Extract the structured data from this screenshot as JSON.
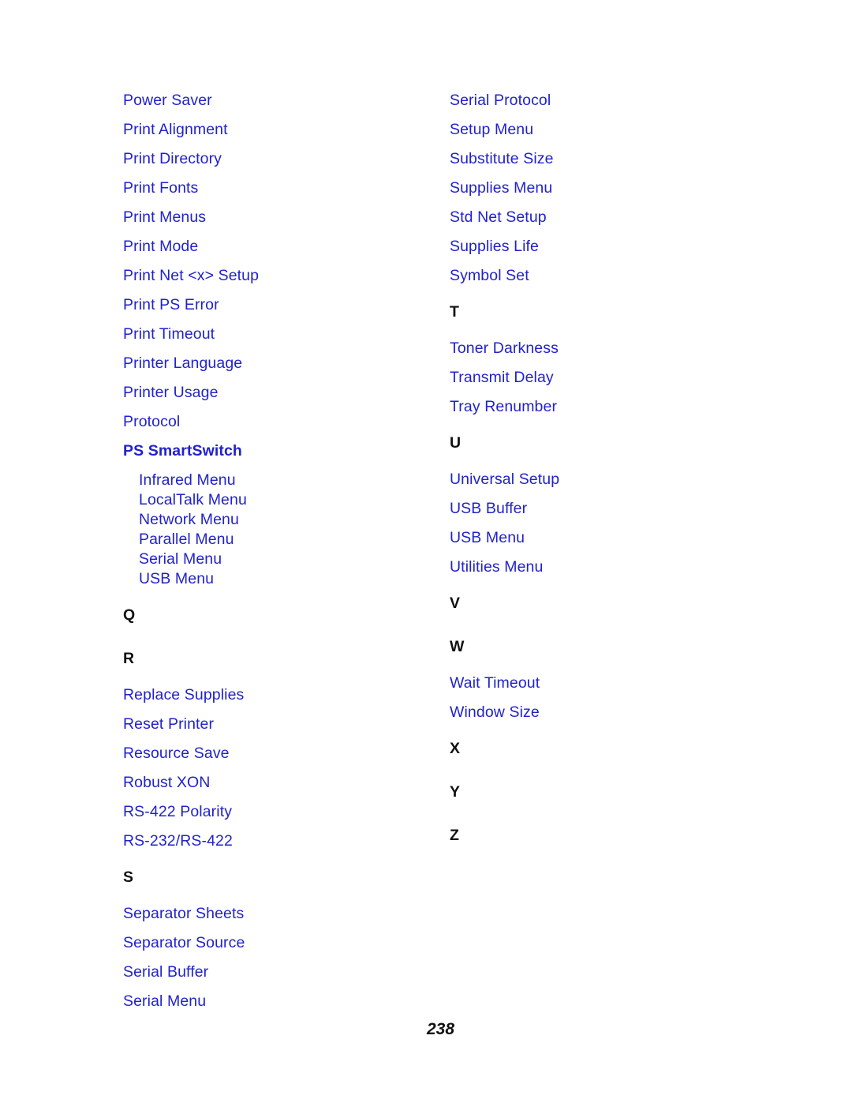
{
  "page": {
    "number": "238",
    "link_color": "#2222cc",
    "heading_color": "#111111",
    "background_color": "#ffffff"
  },
  "columns": {
    "left": [
      {
        "kind": "entry",
        "text": "Power Saver"
      },
      {
        "kind": "entry",
        "text": "Print Alignment"
      },
      {
        "kind": "entry",
        "text": "Print Directory"
      },
      {
        "kind": "entry",
        "text": "Print Fonts"
      },
      {
        "kind": "entry",
        "text": "Print Menus"
      },
      {
        "kind": "entry",
        "text": "Print Mode"
      },
      {
        "kind": "entry",
        "text": "Print Net <x> Setup"
      },
      {
        "kind": "entry",
        "text": "Print PS Error"
      },
      {
        "kind": "entry",
        "text": "Print Timeout"
      },
      {
        "kind": "entry",
        "text": "Printer Language"
      },
      {
        "kind": "entry",
        "text": "Printer Usage"
      },
      {
        "kind": "entry",
        "text": "Protocol"
      },
      {
        "kind": "entry-bold",
        "text": "PS SmartSwitch"
      },
      {
        "kind": "sub",
        "text": "Infrared Menu"
      },
      {
        "kind": "sub",
        "text": "LocalTalk Menu"
      },
      {
        "kind": "sub",
        "text": "Network Menu"
      },
      {
        "kind": "sub",
        "text": "Parallel Menu"
      },
      {
        "kind": "sub",
        "text": "Serial Menu"
      },
      {
        "kind": "sub",
        "text": "USB Menu"
      },
      {
        "kind": "gap",
        "text": ""
      },
      {
        "kind": "letter",
        "text": "Q"
      },
      {
        "kind": "letter",
        "text": "R"
      },
      {
        "kind": "entry",
        "text": "Replace Supplies"
      },
      {
        "kind": "entry",
        "text": "Reset Printer"
      },
      {
        "kind": "entry",
        "text": "Resource Save"
      },
      {
        "kind": "entry",
        "text": "Robust XON"
      },
      {
        "kind": "entry",
        "text": "RS-422 Polarity"
      },
      {
        "kind": "entry",
        "text": "RS-232/RS-422"
      },
      {
        "kind": "letter",
        "text": "S"
      },
      {
        "kind": "entry",
        "text": "Separator Sheets"
      },
      {
        "kind": "entry",
        "text": "Separator Source"
      },
      {
        "kind": "entry",
        "text": "Serial Buffer"
      },
      {
        "kind": "entry",
        "text": "Serial Menu"
      }
    ],
    "right": [
      {
        "kind": "entry",
        "text": "Serial Protocol"
      },
      {
        "kind": "entry",
        "text": "Setup Menu"
      },
      {
        "kind": "entry",
        "text": "Substitute Size"
      },
      {
        "kind": "entry",
        "text": "Supplies Menu"
      },
      {
        "kind": "entry",
        "text": "Std Net Setup"
      },
      {
        "kind": "entry",
        "text": "Supplies Life"
      },
      {
        "kind": "entry",
        "text": "Symbol Set"
      },
      {
        "kind": "letter",
        "text": "T"
      },
      {
        "kind": "entry",
        "text": "Toner Darkness"
      },
      {
        "kind": "entry",
        "text": "Transmit Delay"
      },
      {
        "kind": "entry",
        "text": "Tray Renumber"
      },
      {
        "kind": "letter",
        "text": "U"
      },
      {
        "kind": "entry",
        "text": "Universal Setup"
      },
      {
        "kind": "entry",
        "text": "USB Buffer"
      },
      {
        "kind": "entry",
        "text": "USB Menu"
      },
      {
        "kind": "entry",
        "text": "Utilities Menu"
      },
      {
        "kind": "letter",
        "text": "V"
      },
      {
        "kind": "letter",
        "text": "W"
      },
      {
        "kind": "entry",
        "text": "Wait Timeout"
      },
      {
        "kind": "entry",
        "text": "Window Size"
      },
      {
        "kind": "letter",
        "text": "X"
      },
      {
        "kind": "letter",
        "text": "Y"
      },
      {
        "kind": "letter",
        "text": "Z"
      }
    ]
  }
}
